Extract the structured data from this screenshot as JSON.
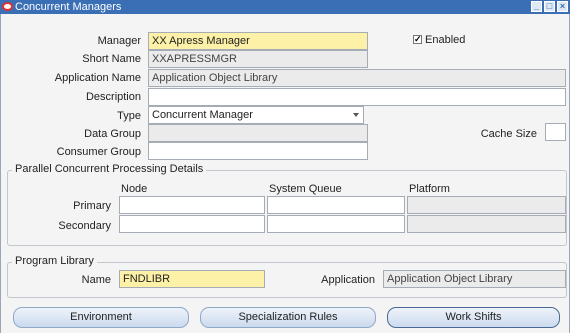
{
  "window": {
    "title": "Concurrent Managers"
  },
  "form": {
    "manager_label": "Manager",
    "manager_value": "XX Apress Manager",
    "enabled_label": "Enabled",
    "enabled_checked": "✓",
    "short_name_label": "Short Name",
    "short_name_value": "XXAPRESSMGR",
    "app_name_label": "Application Name",
    "app_name_value": "Application Object Library",
    "description_label": "Description",
    "description_value": "",
    "type_label": "Type",
    "type_value": "Concurrent Manager",
    "data_group_label": "Data Group",
    "data_group_value": "",
    "cache_size_label": "Cache Size",
    "cache_size_value": "",
    "consumer_group_label": "Consumer Group",
    "consumer_group_value": ""
  },
  "parallel": {
    "title": "Parallel Concurrent Processing Details",
    "col_node": "Node",
    "col_queue": "System Queue",
    "col_platform": "Platform",
    "primary_label": "Primary",
    "secondary_label": "Secondary"
  },
  "program_library": {
    "title": "Program Library",
    "name_label": "Name",
    "name_value": "FNDLIBR",
    "application_label": "Application",
    "application_value": "Application Object Library"
  },
  "buttons": {
    "environment": "Environment",
    "specialization_rules": "Specialization Rules",
    "work_shifts": "Work Shifts"
  }
}
